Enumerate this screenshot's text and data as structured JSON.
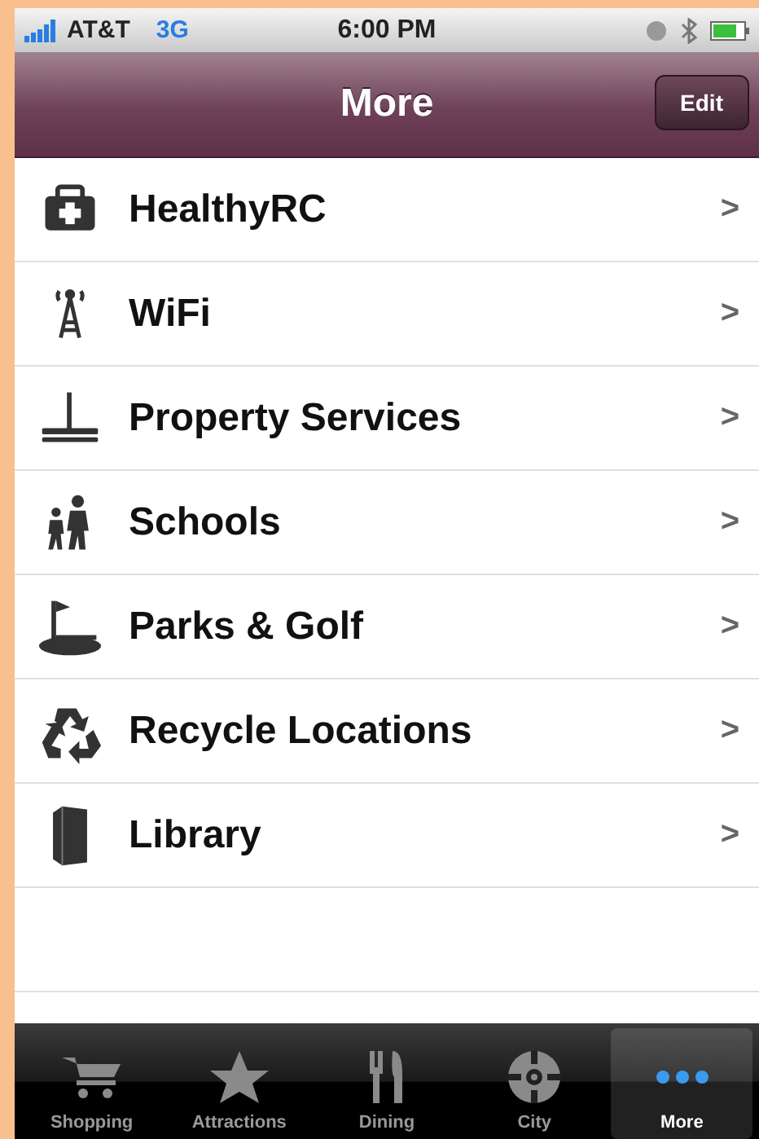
{
  "status_bar": {
    "carrier": "AT&T",
    "network": "3G",
    "time": "6:00 PM"
  },
  "nav_bar": {
    "title": "More",
    "edit_button": "Edit"
  },
  "items": [
    {
      "label": "HealthyRC"
    },
    {
      "label": "WiFi"
    },
    {
      "label": "Property Services"
    },
    {
      "label": "Schools"
    },
    {
      "label": "Parks & Golf"
    },
    {
      "label": "Recycle Locations"
    },
    {
      "label": "Library"
    }
  ],
  "chevron": ">",
  "tab_bar": [
    {
      "label": "Shopping",
      "selected": false
    },
    {
      "label": "Attractions",
      "selected": false
    },
    {
      "label": "Dining",
      "selected": false
    },
    {
      "label": "City",
      "selected": false
    },
    {
      "label": "More",
      "selected": true
    }
  ]
}
